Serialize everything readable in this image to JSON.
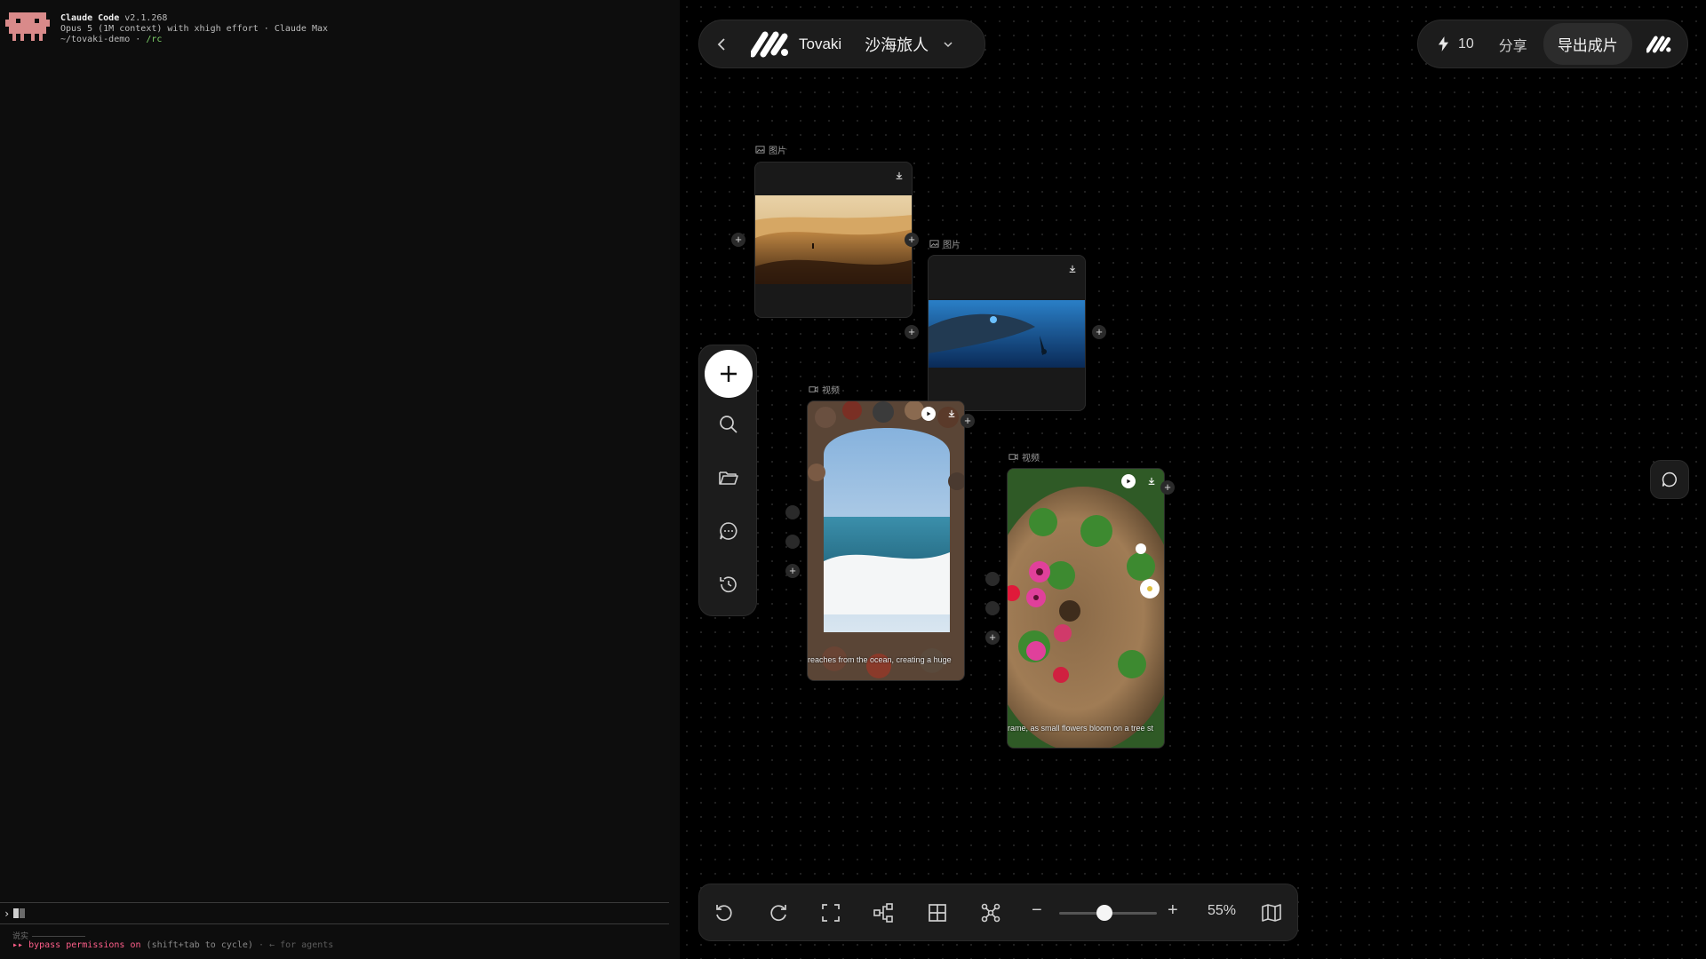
{
  "terminal": {
    "app_name": "Claude Code",
    "version": "v2.1.268",
    "model_line": "Opus 5 (1M context) with xhigh effort · Claude Max",
    "cwd": "~/tovaki-demo · ",
    "rc_cmd": "/rc",
    "prompt_symbol": "›",
    "tip_label": "说实",
    "status_arrows": "▸▸",
    "status_mode": "bypass permissions on",
    "status_hint": "(shift+tab to cycle)",
    "status_extra": "· ← for agents"
  },
  "header": {
    "back_icon": "chevron-left-icon",
    "brand": "Tovaki",
    "project_name": "沙海旅人",
    "dropdown_icon": "chevron-down-icon"
  },
  "topbar": {
    "credits": "10",
    "share_label": "分享",
    "export_label": "导出成片"
  },
  "sidebar": {
    "items": [
      "add-icon",
      "search-icon",
      "folder-icon",
      "chat-icon",
      "history-icon"
    ]
  },
  "cards": {
    "image1": {
      "type_label": "图片"
    },
    "image2": {
      "type_label": "图片"
    },
    "video1": {
      "type_label": "视频",
      "caption": "reaches from the ocean, creating a huge"
    },
    "video2": {
      "type_label": "视频",
      "caption": "rame, as small flowers bloom on a tree st"
    }
  },
  "bottombar": {
    "zoom_value": "55%",
    "zoom_fraction": 0.46
  },
  "colors": {
    "canvas_bg": "#000000",
    "panel_bg": "#1c1c1c",
    "accent_pink": "#ff5f8a"
  }
}
